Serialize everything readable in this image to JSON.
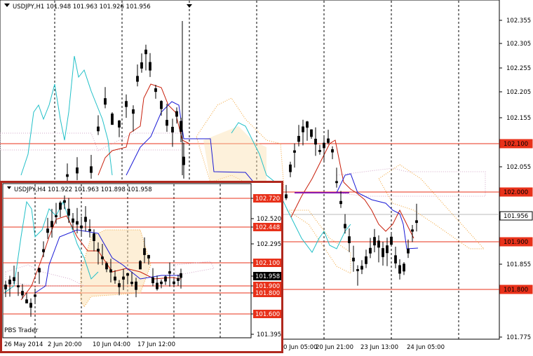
{
  "main_chart": {
    "title": "USDJPY,H1  101.948 101.963 101.926 101.956",
    "axis_ticks": [
      "102.355",
      "102.305",
      "102.255",
      "102.205",
      "102.155",
      "102.100",
      "102.055",
      "102.000",
      "101.956",
      "101.900",
      "101.855",
      "101.800",
      "101.775"
    ],
    "time_ticks": [
      "0 Jun 05:00",
      "20 Jun 21:00",
      "23 Jun 13:00",
      "24 Jun 05:00"
    ],
    "price_tags": [
      {
        "label": "102.100",
        "color": "#e8311a"
      },
      {
        "label": "102.000",
        "color": "#e8311a"
      },
      {
        "label": "101.956",
        "color": "#ffffff",
        "text_color": "#000000"
      },
      {
        "label": "101.900",
        "color": "#e8311a"
      },
      {
        "label": "101.800",
        "color": "#e8311a"
      }
    ],
    "hlines": [
      "102.100",
      "102.000",
      "101.900",
      "101.800"
    ]
  },
  "inset_chart": {
    "title": "USDJPY,H4  101.922 101.963 101.898 101.958",
    "axis_ticks": [
      "102.720",
      "102.520",
      "102.448",
      "102.295",
      "102.100",
      "101.958",
      "101.900",
      "101.800",
      "101.600",
      "101.395"
    ],
    "time_ticks": [
      "26 May 2014",
      "2 Jun 20:00",
      "10 Jun 04:00",
      "17 Jun 12:00"
    ],
    "price_tags": [
      {
        "label": "102.720",
        "color": "#e8311a"
      },
      {
        "label": "102.448",
        "color": "#e8311a"
      },
      {
        "label": "102.100",
        "color": "#e8311a"
      },
      {
        "label": "101.958",
        "color": "#000000"
      },
      {
        "label": "101.900",
        "color": "#e8311a"
      },
      {
        "label": "101.800",
        "color": "#e8311a"
      },
      {
        "label": "101.600",
        "color": "#e8311a"
      }
    ],
    "watermark": "PBS Trader"
  },
  "colors": {
    "level": "#e8311a",
    "kijun": "#1a1ad6",
    "tenkan": "#c81e0a",
    "chikou": "#22c0c8",
    "cloud_bull": "#f0a030",
    "cloud_bear": "#d2a8c8",
    "border": "#b0281e"
  }
}
